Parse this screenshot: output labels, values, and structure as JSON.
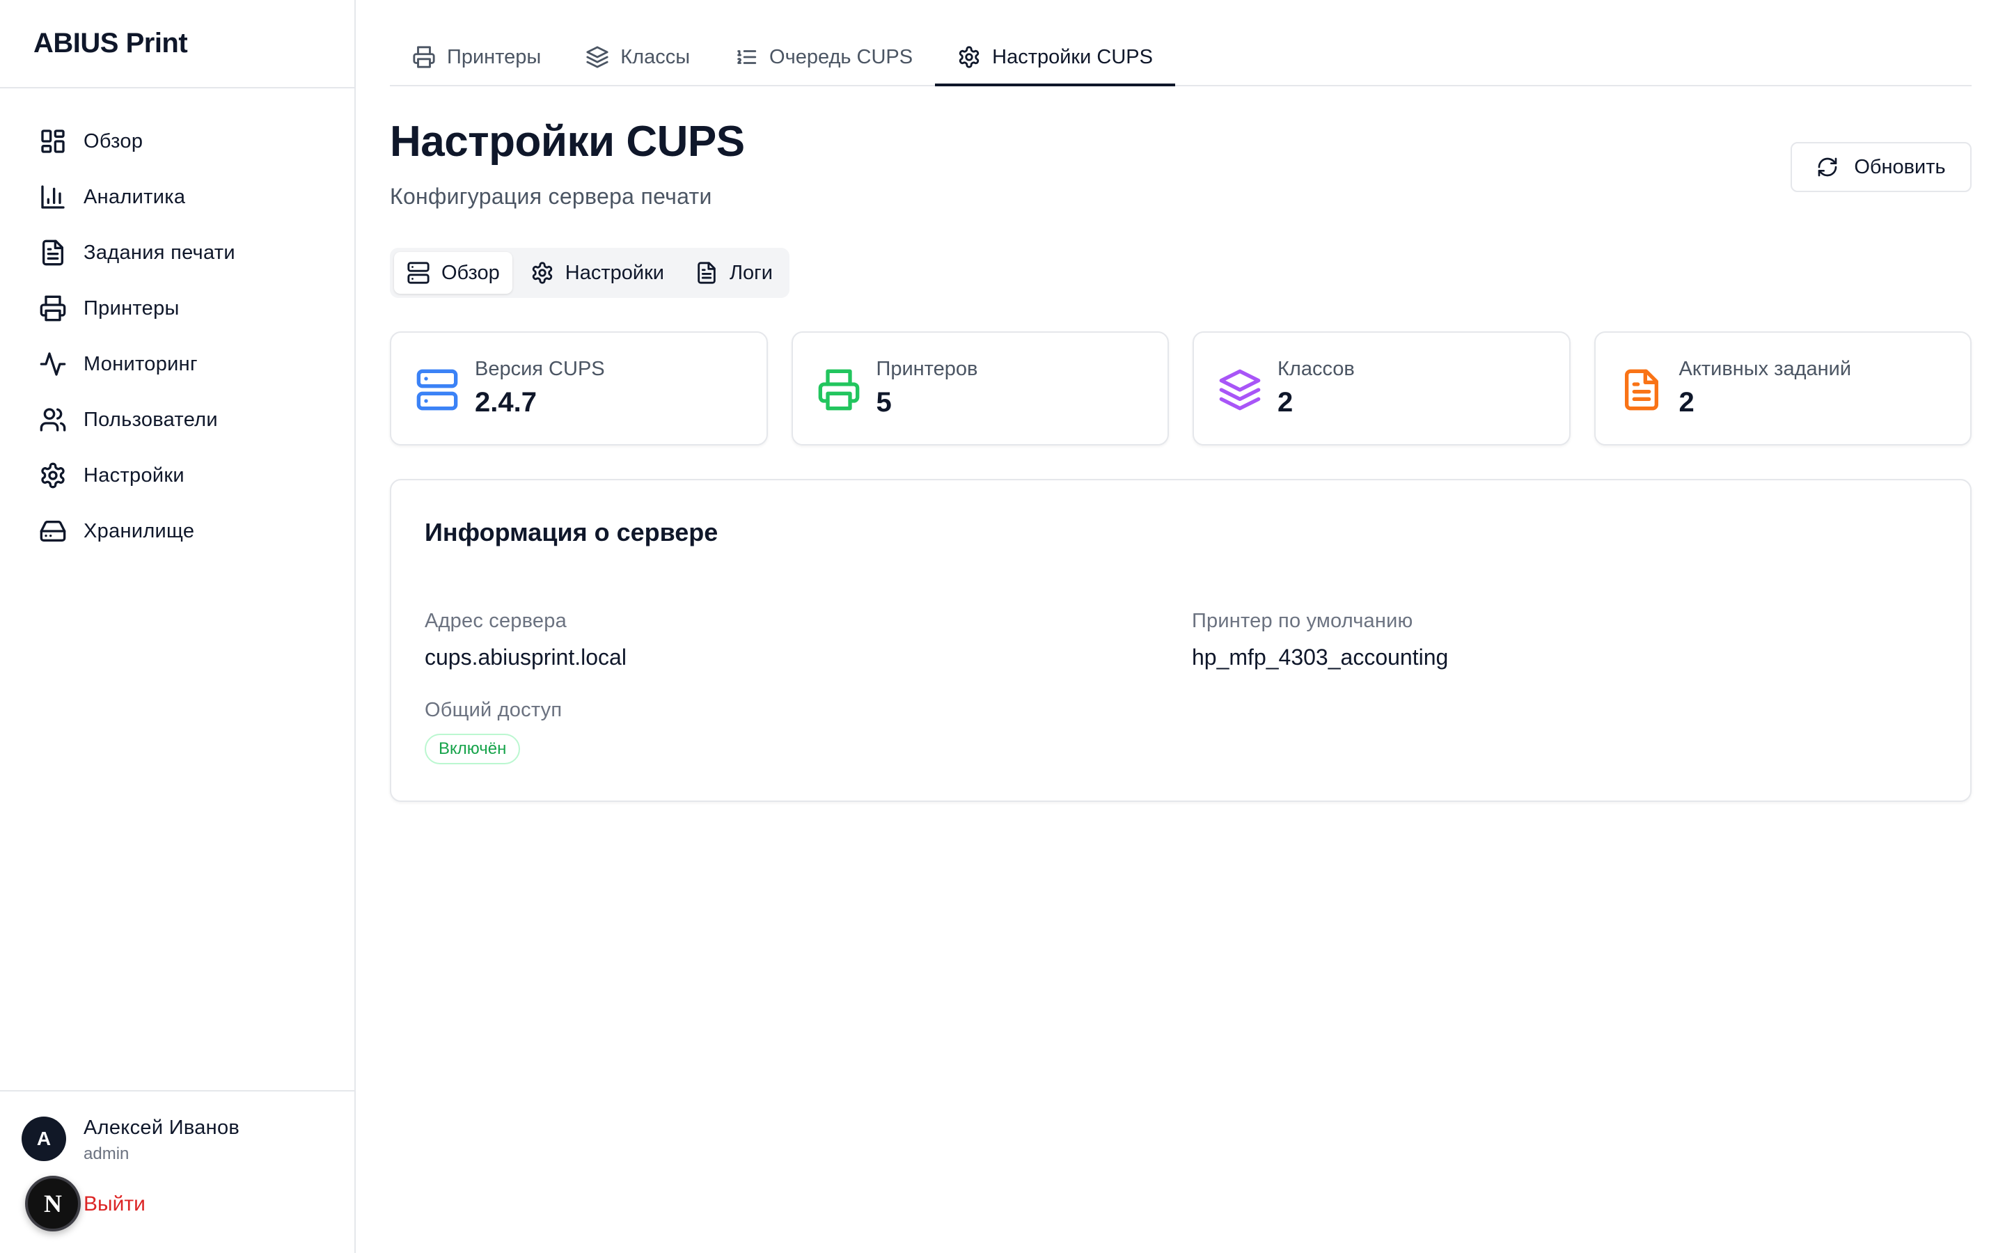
{
  "app": {
    "title": "ABIUS Print"
  },
  "sidebar": {
    "items": [
      {
        "label": "Обзор",
        "icon": "dashboard-icon"
      },
      {
        "label": "Аналитика",
        "icon": "bar-chart-icon"
      },
      {
        "label": "Задания печати",
        "icon": "file-text-icon"
      },
      {
        "label": "Принтеры",
        "icon": "printer-icon"
      },
      {
        "label": "Мониторинг",
        "icon": "activity-icon"
      },
      {
        "label": "Пользователи",
        "icon": "users-icon"
      },
      {
        "label": "Настройки",
        "icon": "settings-icon"
      },
      {
        "label": "Хранилище",
        "icon": "hard-drive-icon"
      }
    ]
  },
  "user": {
    "initial": "А",
    "name": "Алексей Иванов",
    "role": "admin",
    "logout_label": "Выйти",
    "badge_letter": "N"
  },
  "top_tabs": [
    {
      "label": "Принтеры",
      "icon": "printer-icon",
      "active": false
    },
    {
      "label": "Классы",
      "icon": "layers-icon",
      "active": false
    },
    {
      "label": "Очередь CUPS",
      "icon": "list-ordered-icon",
      "active": false
    },
    {
      "label": "Настройки CUPS",
      "icon": "settings-icon",
      "active": true
    }
  ],
  "page": {
    "title": "Настройки CUPS",
    "subtitle": "Конфигурация сервера печати",
    "refresh_label": "Обновить"
  },
  "sub_tabs": [
    {
      "label": "Обзор",
      "icon": "server-icon",
      "active": true
    },
    {
      "label": "Настройки",
      "icon": "settings-icon",
      "active": false
    },
    {
      "label": "Логи",
      "icon": "file-text-icon",
      "active": false
    }
  ],
  "stats": [
    {
      "label": "Версия CUPS",
      "value": "2.4.7",
      "icon": "server-icon",
      "color": "#3b82f6"
    },
    {
      "label": "Принтеров",
      "value": "5",
      "icon": "printer-icon",
      "color": "#22c55e"
    },
    {
      "label": "Классов",
      "value": "2",
      "icon": "layers-icon",
      "color": "#a855f7"
    },
    {
      "label": "Активных заданий",
      "value": "2",
      "icon": "file-text-icon",
      "color": "#f97316"
    }
  ],
  "server_info": {
    "title": "Информация о сервере",
    "address_label": "Адрес сервера",
    "address_value": "cups.abiusprint.local",
    "default_printer_label": "Принтер по умолчанию",
    "default_printer_value": "hp_mfp_4303_accounting",
    "sharing_label": "Общий доступ",
    "sharing_status": "Включён",
    "sharing_status_color": "#16a34a"
  }
}
